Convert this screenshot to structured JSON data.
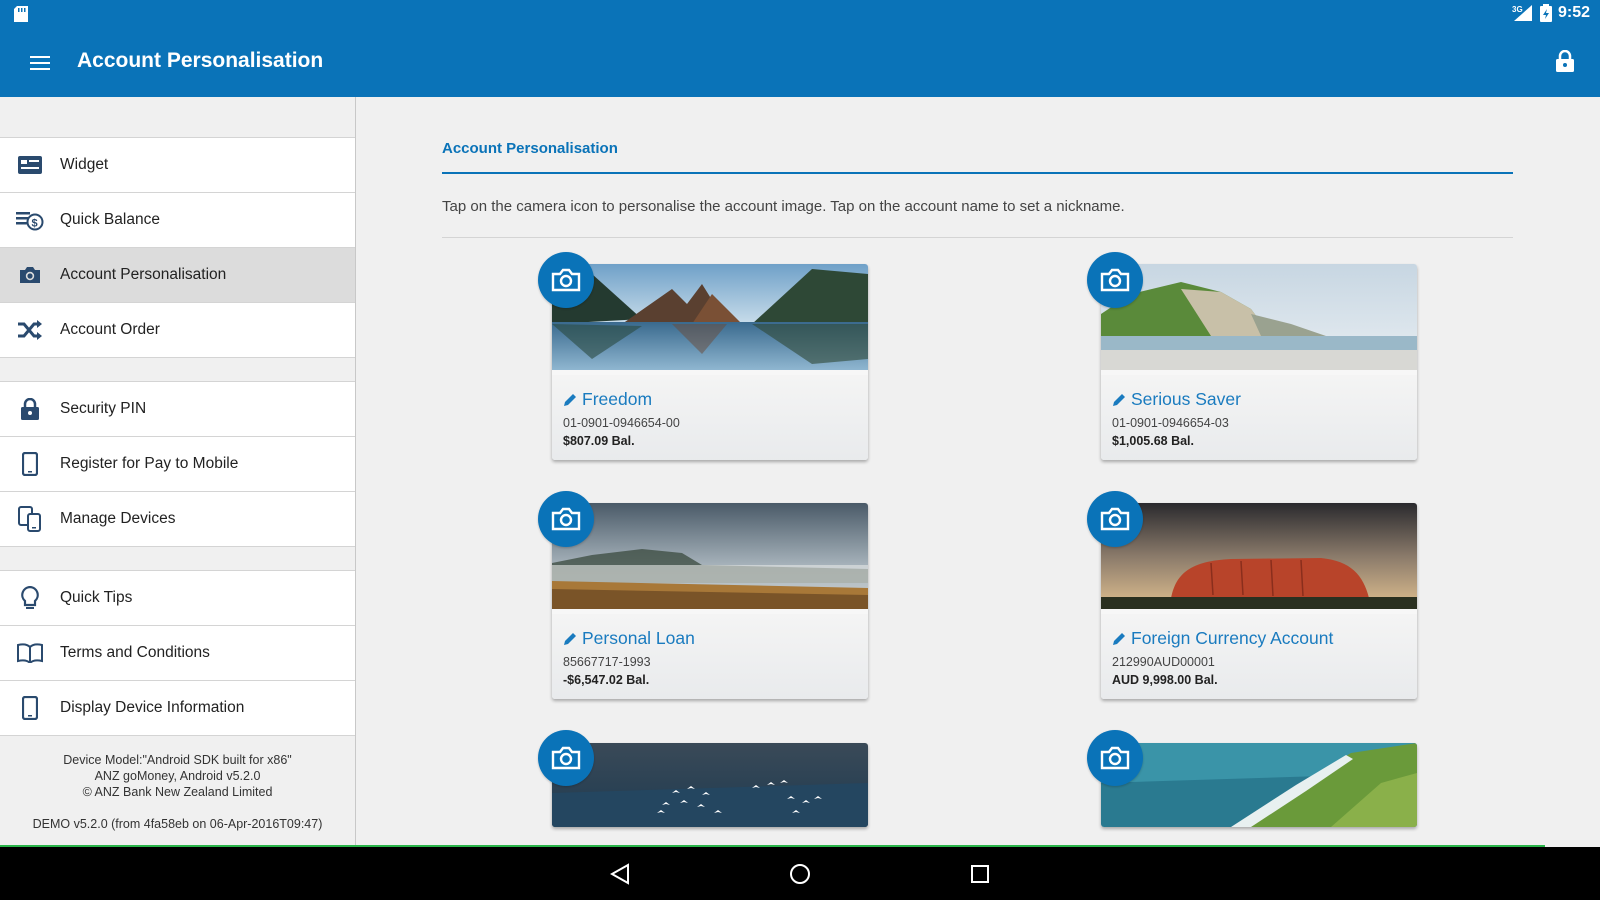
{
  "status_bar": {
    "network": "3G",
    "time": "9:52"
  },
  "app_bar": {
    "title": "Account Personalisation"
  },
  "sidebar": {
    "group1": [
      {
        "label": "Widget",
        "icon": "widget-icon"
      },
      {
        "label": "Quick Balance",
        "icon": "quick-balance-icon"
      },
      {
        "label": "Account Personalisation",
        "icon": "camera-icon",
        "active": true
      },
      {
        "label": "Account Order",
        "icon": "shuffle-icon"
      }
    ],
    "group2": [
      {
        "label": "Security PIN",
        "icon": "lock-icon"
      },
      {
        "label": "Register for Pay to Mobile",
        "icon": "phone-icon"
      },
      {
        "label": "Manage Devices",
        "icon": "devices-icon"
      }
    ],
    "group3": [
      {
        "label": "Quick Tips",
        "icon": "lightbulb-icon"
      },
      {
        "label": "Terms and Conditions",
        "icon": "book-icon"
      },
      {
        "label": "Display Device Information",
        "icon": "phone-icon"
      }
    ],
    "footer": {
      "line1": "Device Model:\"Android SDK built for x86\"",
      "line2": "ANZ goMoney, Android  v5.2.0",
      "line3": "© ANZ Bank New Zealand Limited",
      "demo": "DEMO v5.2.0 (from 4fa58eb on 06-Apr-2016T09:47)"
    }
  },
  "main": {
    "section_title": "Account Personalisation",
    "instructions": "Tap on the camera icon to personalise the account image. Tap on the account name to set a nickname.",
    "accounts": [
      {
        "name": "Freedom",
        "number": "01-0901-0946654-00",
        "balance": "$807.09 Bal.",
        "image": "mountain-lake"
      },
      {
        "name": "Serious Saver",
        "number": "01-0901-0946654-03",
        "balance": "$1,005.68 Bal.",
        "image": "coastal-hills"
      },
      {
        "name": "Personal Loan",
        "number": "85667717-1993",
        "balance": "-$6,547.02 Bal.",
        "image": "misty-beach"
      },
      {
        "name": "Foreign Currency Account",
        "number": "212990AUD00001",
        "balance": "AUD 9,998.00 Bal.",
        "image": "uluru"
      },
      {
        "name": "",
        "number": "",
        "balance": "",
        "image": "birds-over-water"
      },
      {
        "name": "",
        "number": "",
        "balance": "",
        "image": "green-coastline"
      }
    ]
  },
  "colors": {
    "primary": "#0a73b8",
    "link": "#1a7bbf",
    "accent_line": "#2ab54a"
  }
}
